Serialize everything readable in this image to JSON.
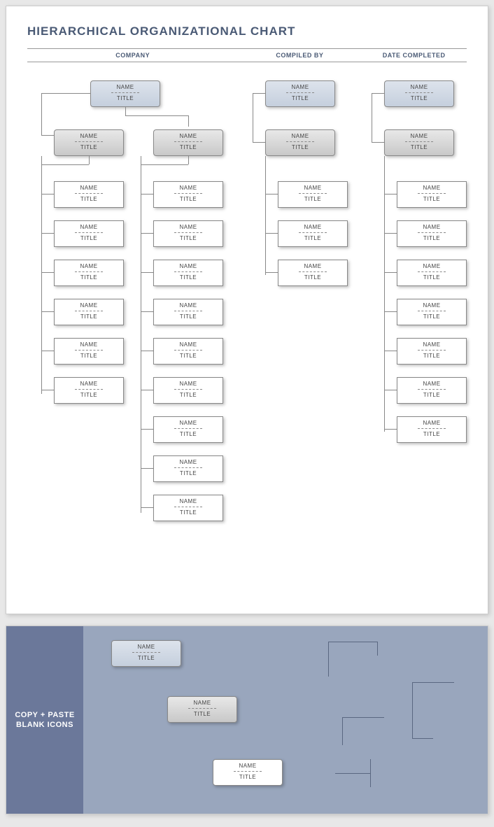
{
  "chart_data": {
    "type": "org_chart",
    "title": "HIERARCHICAL ORGANIZATIONAL CHART",
    "header_fields": [
      "COMPANY",
      "COMPILED BY",
      "DATE COMPLETED"
    ],
    "nodes": {
      "name_label": "NAME",
      "title_label": "TITLE"
    },
    "trees": [
      {
        "top": 1,
        "managers": [
          {
            "children": 6
          },
          {
            "children": 9
          }
        ]
      },
      {
        "top": 1,
        "managers": [
          {
            "children": 3
          }
        ]
      },
      {
        "top": 1,
        "managers": [
          {
            "children": 7
          }
        ]
      }
    ]
  },
  "title": "HIERARCHICAL ORGANIZATIONAL CHART",
  "header": {
    "col1": "COMPANY",
    "col2": "COMPILED BY",
    "col3": "DATE COMPLETED"
  },
  "node": {
    "name": "NAME",
    "title": "TITLE"
  },
  "copy_panel": {
    "label": "COPY + PASTE BLANK ICONS"
  }
}
